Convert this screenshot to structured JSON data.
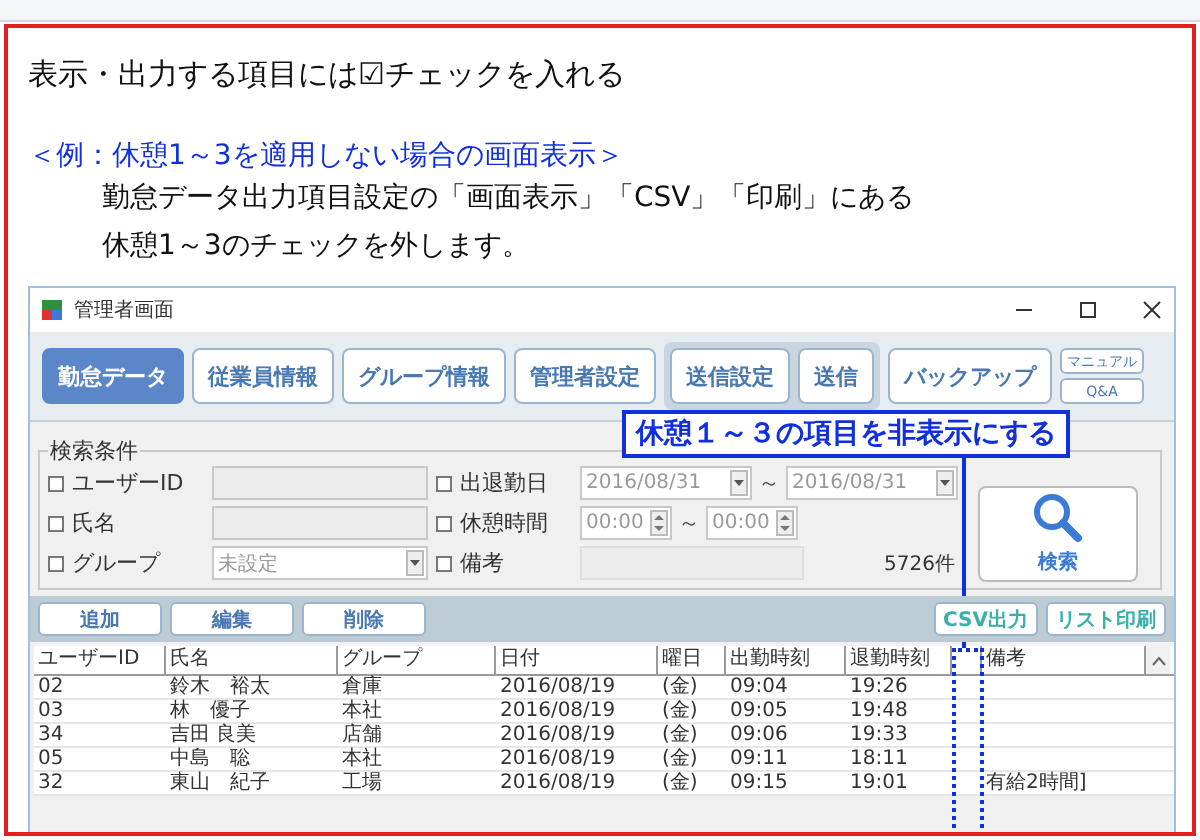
{
  "instruction": {
    "heading": "表示・出力する項目には☑チェックを入れる",
    "example_title": "＜例：休憩1～3を適用しない場合の画面表示＞",
    "body": [
      "勤怠データ出力項目設定の「画面表示」「CSV」「印刷」にある",
      "休憩1～3のチェックを外します。"
    ]
  },
  "window": {
    "title": "管理者画面"
  },
  "nav": {
    "main": [
      {
        "label": "勤怠データ",
        "selected": true
      },
      {
        "label": "従業員情報",
        "selected": false
      },
      {
        "label": "グループ情報",
        "selected": false
      },
      {
        "label": "管理者設定",
        "selected": false
      }
    ],
    "send": [
      {
        "label": "送信設定",
        "selected": false
      },
      {
        "label": "送信",
        "selected": false
      }
    ],
    "backup": "バックアップ",
    "help": [
      "マニュアル",
      "Q&A"
    ]
  },
  "search": {
    "legend": "検索条件",
    "left": [
      {
        "label": "ユーザーID",
        "checked": false,
        "kind": "text"
      },
      {
        "label": "氏名",
        "checked": false,
        "kind": "text"
      },
      {
        "label": "グループ",
        "checked": false,
        "kind": "select",
        "value": "未設定"
      }
    ],
    "middle": [
      {
        "label": "出退勤日",
        "checked": false,
        "kind": "date",
        "from": "2016/08/31",
        "sep": "～",
        "to": "2016/08/31"
      },
      {
        "label": "休憩時間",
        "checked": false,
        "kind": "time",
        "from": "00:00",
        "sep": "～",
        "to": "00:00"
      },
      {
        "label": "備考",
        "checked": false,
        "kind": "text"
      }
    ],
    "count": "5726件",
    "button": "検索"
  },
  "actions": [
    "追加",
    "編集",
    "削除"
  ],
  "outputs": [
    "CSV出力",
    "リスト印刷"
  ],
  "table": {
    "columns": [
      "ユーザーID",
      "氏名",
      "グループ",
      "日付",
      "曜日",
      "出勤時刻",
      "退勤時刻",
      "",
      "備考"
    ],
    "rows": [
      [
        "02",
        "鈴木　裕太",
        "倉庫",
        "2016/08/19",
        "(金)",
        "09:04",
        "19:26",
        "",
        ""
      ],
      [
        "03",
        "林　優子",
        "本社",
        "2016/08/19",
        "(金)",
        "09:05",
        "19:48",
        "",
        ""
      ],
      [
        "34",
        "吉田 良美",
        "店舗",
        "2016/08/19",
        "(金)",
        "09:06",
        "19:33",
        "",
        ""
      ],
      [
        "05",
        "中島　聡",
        "本社",
        "2016/08/19",
        "(金)",
        "09:11",
        "18:11",
        "",
        ""
      ],
      [
        "32",
        "東山　紀子",
        "工場",
        "2016/08/19",
        "(金)",
        "09:15",
        "19:01",
        "",
        "有給2時間]"
      ]
    ]
  },
  "callout": "休憩１～３の項目を非表示にする"
}
